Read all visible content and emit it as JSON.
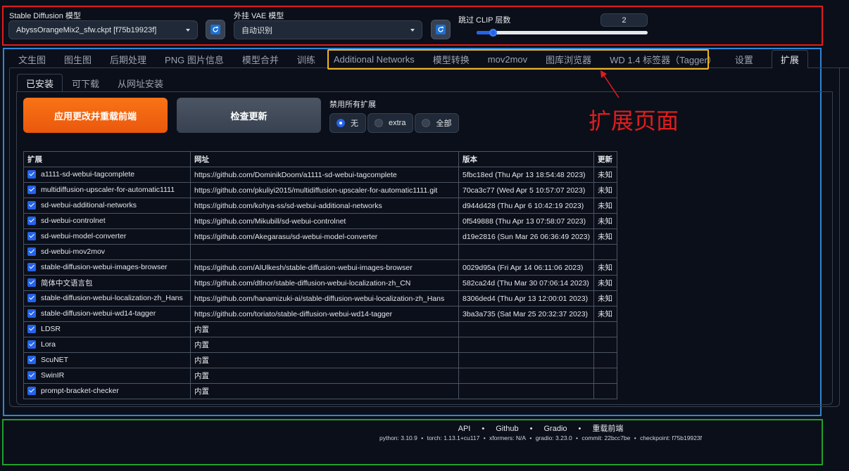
{
  "top": {
    "sd_model_label": "Stable Diffusion 模型",
    "sd_model_value": "AbyssOrangeMix2_sfw.ckpt [f75b19923f]",
    "vae_label": "外挂 VAE 模型",
    "vae_value": "自动识别",
    "clip_label": "跳过 CLIP 层数",
    "clip_value": "2",
    "clip_slider_fraction": 0.1
  },
  "tabs": [
    "文生图",
    "图生图",
    "后期处理",
    "PNG 图片信息",
    "模型合并",
    "训练",
    "Additional Networks",
    "模型转换",
    "mov2mov",
    "图库浏览器",
    "WD 1.4 标签器（Tagger）",
    "设置",
    "扩展"
  ],
  "subtabs": [
    "已安装",
    "可下载",
    "从网址安装"
  ],
  "buttons": {
    "apply": "应用更改并重载前端",
    "check": "检查更新"
  },
  "disable": {
    "label": "禁用所有扩展",
    "options": [
      "无",
      "extra",
      "全部"
    ],
    "selected": "无"
  },
  "annotation": "扩展页面",
  "table": {
    "headers": [
      "扩展",
      "网址",
      "版本",
      "更新"
    ],
    "rows": [
      {
        "name": "a1111-sd-webui-tagcomplete",
        "url": "https://github.com/DominikDoom/a1111-sd-webui-tagcomplete",
        "version": "5fbc18ed (Thu Apr 13 18:54:48 2023)",
        "update": "未知"
      },
      {
        "name": "multidiffusion-upscaler-for-automatic1111",
        "url": "https://github.com/pkuliyi2015/multidiffusion-upscaler-for-automatic1111.git",
        "version": "70ca3c77 (Wed Apr 5 10:57:07 2023)",
        "update": "未知"
      },
      {
        "name": "sd-webui-additional-networks",
        "url": "https://github.com/kohya-ss/sd-webui-additional-networks",
        "version": "d944d428 (Thu Apr 6 10:42:19 2023)",
        "update": "未知"
      },
      {
        "name": "sd-webui-controlnet",
        "url": "https://github.com/Mikubill/sd-webui-controlnet",
        "version": "0f549888 (Thu Apr 13 07:58:07 2023)",
        "update": "未知"
      },
      {
        "name": "sd-webui-model-converter",
        "url": "https://github.com/Akegarasu/sd-webui-model-converter",
        "version": "d19e2816 (Sun Mar 26 06:36:49 2023)",
        "update": "未知"
      },
      {
        "name": "sd-webui-mov2mov",
        "url": "",
        "version": "",
        "update": ""
      },
      {
        "name": "stable-diffusion-webui-images-browser",
        "url": "https://github.com/AlUlkesh/stable-diffusion-webui-images-browser",
        "version": "0029d95a (Fri Apr 14 06:11:06 2023)",
        "update": "未知"
      },
      {
        "name": "简体中文语言包",
        "url": "https://github.com/dtlnor/stable-diffusion-webui-localization-zh_CN",
        "version": "582ca24d (Thu Mar 30 07:06:14 2023)",
        "update": "未知"
      },
      {
        "name": "stable-diffusion-webui-localization-zh_Hans",
        "url": "https://github.com/hanamizuki-ai/stable-diffusion-webui-localization-zh_Hans",
        "version": "8306ded4 (Thu Apr 13 12:00:01 2023)",
        "update": "未知"
      },
      {
        "name": "stable-diffusion-webui-wd14-tagger",
        "url": "https://github.com/toriato/stable-diffusion-webui-wd14-tagger",
        "version": "3ba3a735 (Sat Mar 25 20:32:37 2023)",
        "update": "未知"
      },
      {
        "name": "LDSR",
        "url": "内置",
        "version": "",
        "update": ""
      },
      {
        "name": "Lora",
        "url": "内置",
        "version": "",
        "update": ""
      },
      {
        "name": "ScuNET",
        "url": "内置",
        "version": "",
        "update": ""
      },
      {
        "name": "SwinIR",
        "url": "内置",
        "version": "",
        "update": ""
      },
      {
        "name": "prompt-bracket-checker",
        "url": "内置",
        "version": "",
        "update": ""
      }
    ]
  },
  "footer": {
    "links": [
      "API",
      "Github",
      "Gradio",
      "重载前端"
    ],
    "separator": "•",
    "versions": [
      "python: 3.10.9",
      "torch: 1.13.1+cu117",
      "xformers: N/A",
      "gradio: 3.23.0",
      "commit: 22bcc7be",
      "checkpoint: f75b19923f"
    ]
  },
  "colors": {
    "annotation_red": "#e11d1d",
    "annotation_blue": "#2f86d6",
    "annotation_yellow": "#f2b51a",
    "annotation_green": "#22a02c",
    "accent_orange": "#f97316",
    "accent_blue": "#2563eb"
  }
}
